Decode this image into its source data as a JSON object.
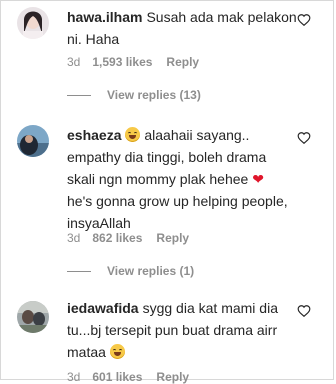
{
  "comments": [
    {
      "username": "hawa.ilham",
      "text": "Susah ada mak pelakon ni. Haha",
      "time": "3d",
      "likes": "1,593 likes",
      "reply": "Reply",
      "view_replies": "View replies (13)"
    },
    {
      "username": "eshaeza",
      "text_before": "alaahaii sayang.. empathy dia tinggi, boleh drama skali ngn mommy plak hehee",
      "text_after": "he's gonna grow up helping people, insyaAllah",
      "time": "3d",
      "likes": "862 likes",
      "reply": "Reply",
      "view_replies": "View replies (1)"
    },
    {
      "username": "iedawafida",
      "text": "sygg dia kat mami dia tu...bj tersepit pun buat drama airr mataa",
      "time": "3d",
      "likes": "601 likes",
      "reply": "Reply"
    }
  ],
  "icons": {
    "like": "heart-outline-icon",
    "grinning_emoji": "grinning-face-emoji",
    "red_heart_emoji": "red-heart-emoji"
  },
  "colors": {
    "text": "#262626",
    "secondary": "#8e8e8e",
    "heart_emoji": "#e0162b"
  }
}
